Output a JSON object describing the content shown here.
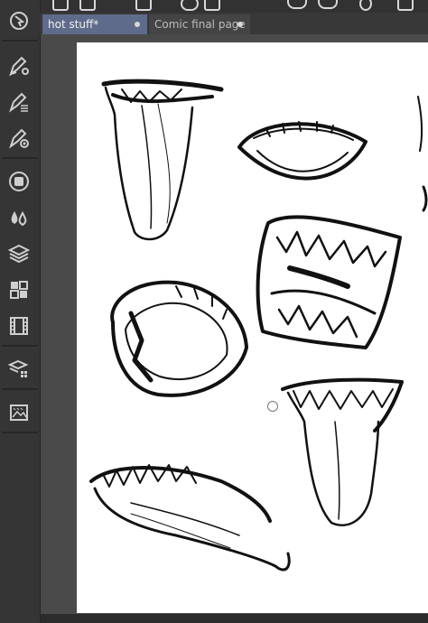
{
  "tabs": [
    {
      "label": "hot stuff*",
      "active": true
    },
    {
      "label": "Comic final page",
      "active": false
    }
  ],
  "tools": [
    {
      "icon": "subtool-icon"
    },
    {
      "icon": "pen-settings-icon"
    },
    {
      "icon": "pen-list-icon"
    },
    {
      "icon": "pen-target-icon"
    },
    {
      "icon": "color-circle-icon"
    },
    {
      "icon": "color-drops-icon"
    },
    {
      "icon": "layers-icon"
    },
    {
      "icon": "material-grid-icon"
    },
    {
      "icon": "film-strip-icon"
    },
    {
      "icon": "layer-property-icon"
    },
    {
      "icon": "image-panel-icon"
    }
  ],
  "colors": {
    "active_tab": "#5e6b8a",
    "inactive_tab": "#444444",
    "panel": "#353535",
    "workspace": "#4a4a4a",
    "canvas": "#ffffff"
  }
}
